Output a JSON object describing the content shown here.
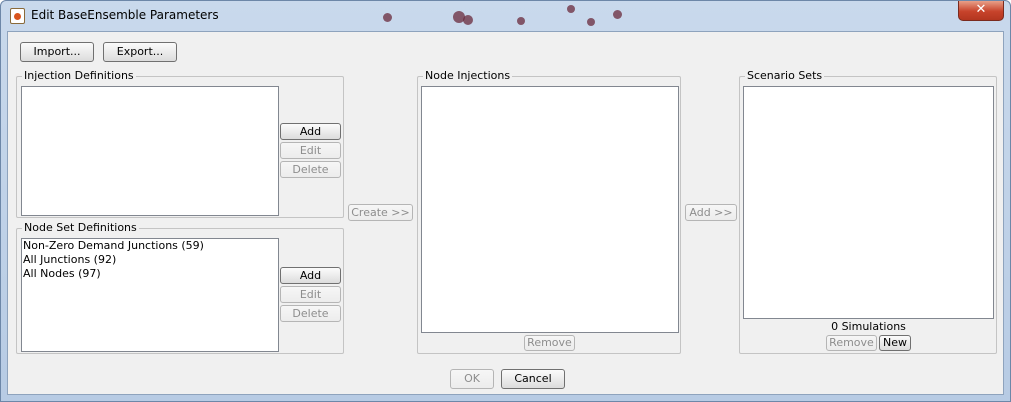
{
  "window": {
    "title": "Edit BaseEnsemble Parameters"
  },
  "toolbar": {
    "import_label": "Import...",
    "export_label": "Export..."
  },
  "injection_definitions": {
    "label": "Injection Definitions",
    "add_label": "Add",
    "edit_label": "Edit",
    "delete_label": "Delete",
    "items": []
  },
  "node_set_definitions": {
    "label": "Node Set Definitions",
    "items": [
      {
        "label": "Non-Zero Demand Junctions (59)"
      },
      {
        "label": "All Junctions (92)"
      },
      {
        "label": "All Nodes (97)"
      }
    ],
    "add_label": "Add",
    "edit_label": "Edit",
    "delete_label": "Delete"
  },
  "create_label": "Create >>",
  "node_injections": {
    "label": "Node Injections",
    "remove_label": "Remove",
    "items": []
  },
  "add_to_sets_label": "Add >>",
  "scenario_sets": {
    "label": "Scenario Sets",
    "simulations_text": "0 Simulations",
    "remove_label": "Remove",
    "new_label": "New",
    "items": []
  },
  "footer": {
    "ok_label": "OK",
    "cancel_label": "Cancel"
  }
}
